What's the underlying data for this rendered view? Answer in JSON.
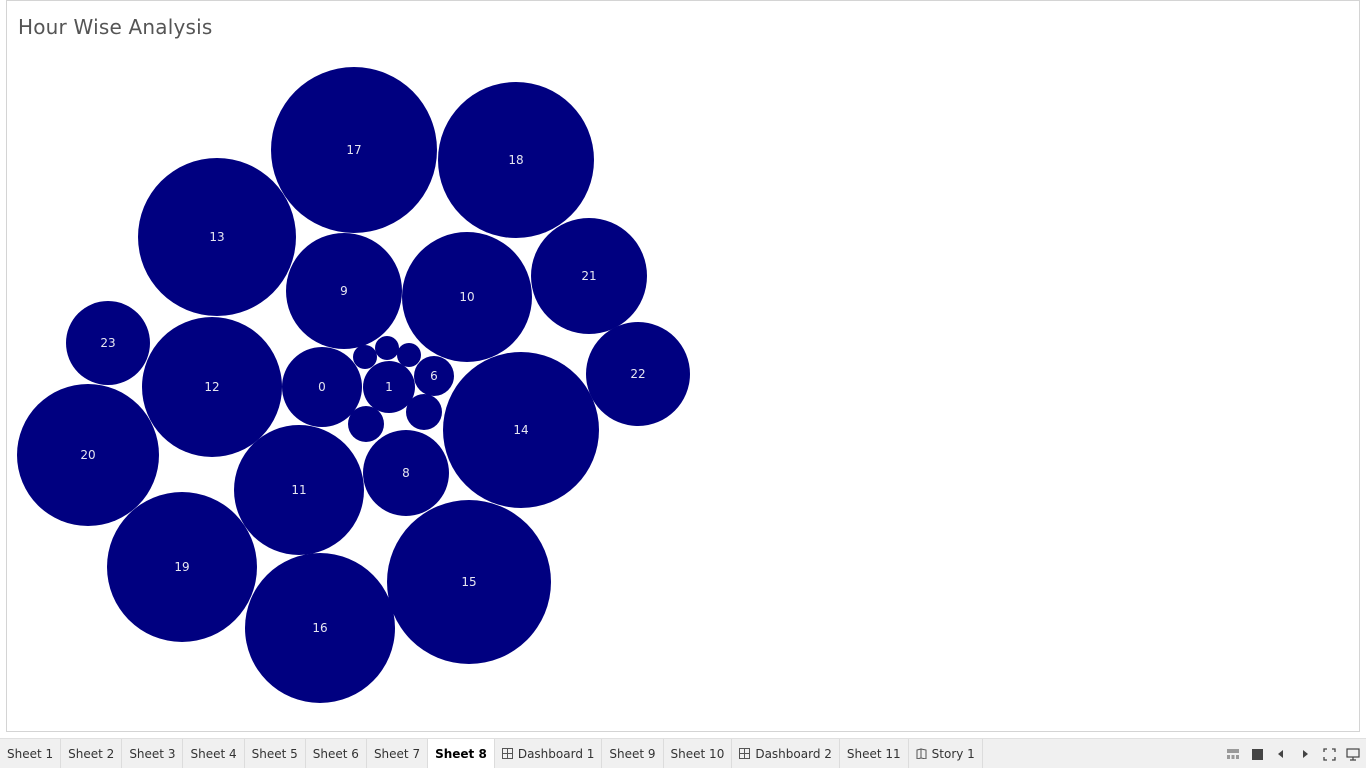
{
  "worksheet": {
    "title": "Hour Wise Analysis"
  },
  "chart_data": {
    "type": "packed-bubble",
    "title": "Hour Wise Analysis",
    "color": "#000080",
    "label_color": "#e6e6f0",
    "bubbles": [
      {
        "label": "17",
        "value": 27
      },
      {
        "label": "18",
        "value": 24
      },
      {
        "label": "13",
        "value": 25
      },
      {
        "label": "9",
        "value": 13
      },
      {
        "label": "10",
        "value": 17
      },
      {
        "label": "21",
        "value": 13
      },
      {
        "label": "23",
        "value": 7
      },
      {
        "label": "12",
        "value": 19
      },
      {
        "label": "0",
        "value": 6
      },
      {
        "label": "1",
        "value": 2.5
      },
      {
        "label": "6",
        "value": 1.5
      },
      {
        "label": "22",
        "value": 10.5
      },
      {
        "label": "20",
        "value": 20
      },
      {
        "label": "14",
        "value": 24
      },
      {
        "label": "11",
        "value": 17
      },
      {
        "label": "8",
        "value": 7.5
      },
      {
        "label": "19",
        "value": 22.5
      },
      {
        "label": "15",
        "value": 27
      },
      {
        "label": "16",
        "value": 22.5
      },
      {
        "label": "",
        "value": 0.5
      },
      {
        "label": "",
        "value": 0.5
      },
      {
        "label": "",
        "value": 0.5
      },
      {
        "label": "",
        "value": 1.2
      },
      {
        "label": "",
        "value": 1.2
      }
    ]
  },
  "tabs": [
    {
      "label": "Sheet 1",
      "kind": "sheet"
    },
    {
      "label": "Sheet 2",
      "kind": "sheet"
    },
    {
      "label": "Sheet 3",
      "kind": "sheet"
    },
    {
      "label": "Sheet 4",
      "kind": "sheet"
    },
    {
      "label": "Sheet 5",
      "kind": "sheet"
    },
    {
      "label": "Sheet 6",
      "kind": "sheet"
    },
    {
      "label": "Sheet 7",
      "kind": "sheet"
    },
    {
      "label": "Sheet 8",
      "kind": "sheet",
      "active": true
    },
    {
      "label": "Dashboard 1",
      "kind": "dashboard"
    },
    {
      "label": "Sheet 9",
      "kind": "sheet"
    },
    {
      "label": "Sheet 10",
      "kind": "sheet"
    },
    {
      "label": "Dashboard 2",
      "kind": "dashboard"
    },
    {
      "label": "Sheet 11",
      "kind": "sheet"
    },
    {
      "label": "Story 1",
      "kind": "story"
    }
  ],
  "controls": {
    "icons": [
      "filmstrip-icon",
      "tabs-icon",
      "previous-sheet-icon",
      "next-sheet-icon",
      "fullscreen-icon",
      "presentation-icon"
    ]
  }
}
